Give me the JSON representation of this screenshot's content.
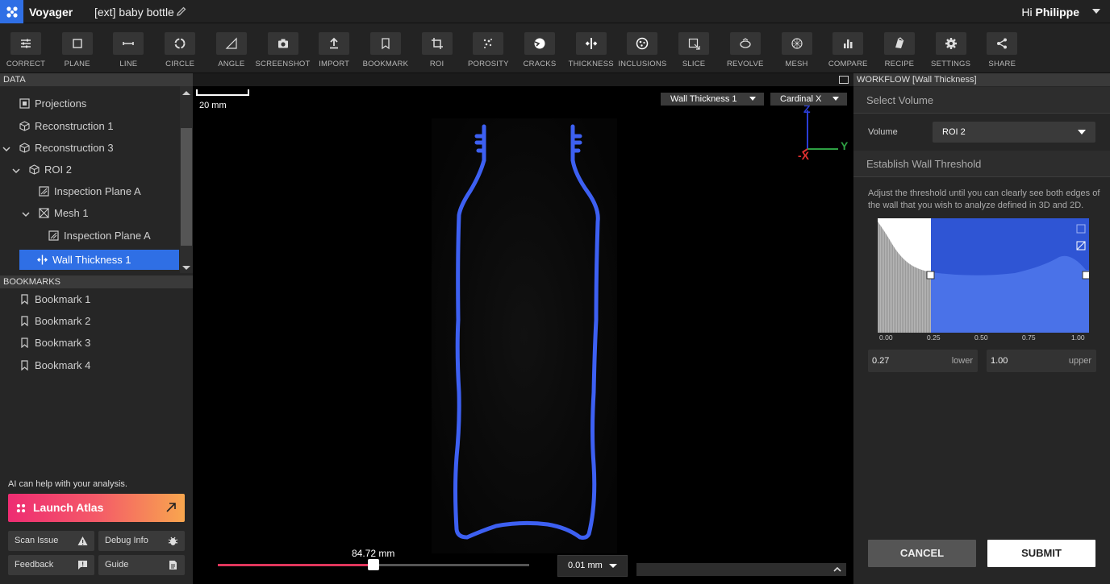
{
  "app": {
    "name": "Voyager",
    "document_title": "[ext] baby bottle",
    "greeting": "Hi",
    "user": "Philippe"
  },
  "toolbar": [
    {
      "label": "CORRECT",
      "icon": "sliders-icon"
    },
    {
      "label": "PLANE",
      "icon": "plane-icon"
    },
    {
      "label": "LINE",
      "icon": "line-icon"
    },
    {
      "label": "CIRCLE",
      "icon": "circle-icon"
    },
    {
      "label": "ANGLE",
      "icon": "angle-icon"
    },
    {
      "label": "SCREENSHOT",
      "icon": "camera-icon"
    },
    {
      "label": "IMPORT",
      "icon": "upload-icon"
    },
    {
      "label": "BOOKMARK",
      "icon": "bookmark-icon"
    },
    {
      "label": "ROI",
      "icon": "crop-icon"
    },
    {
      "label": "POROSITY",
      "icon": "porosity-icon"
    },
    {
      "label": "CRACKS",
      "icon": "cracks-icon"
    },
    {
      "label": "THICKNESS",
      "icon": "thickness-icon"
    },
    {
      "label": "INCLUSIONS",
      "icon": "inclusions-icon"
    },
    {
      "label": "SLICE",
      "icon": "slice-icon"
    },
    {
      "label": "REVOLVE",
      "icon": "revolve-icon"
    },
    {
      "label": "MESH",
      "icon": "mesh-icon"
    },
    {
      "label": "COMPARE",
      "icon": "bar-chart-icon"
    },
    {
      "label": "RECIPE",
      "icon": "recipe-icon"
    },
    {
      "label": "SETTINGS",
      "icon": "gear-icon"
    },
    {
      "label": "SHARE",
      "icon": "share-icon"
    }
  ],
  "data_panel": {
    "header": "DATA",
    "tree": [
      {
        "label": "Projections",
        "icon": "projections-icon"
      },
      {
        "label": "Reconstruction 1",
        "icon": "cube-icon"
      },
      {
        "label": "Reconstruction 3",
        "icon": "cube-icon"
      },
      {
        "label": "ROI 2",
        "icon": "cube-icon"
      },
      {
        "label": "Inspection Plane A",
        "icon": "inspection-plane-icon"
      },
      {
        "label": "Mesh 1",
        "icon": "mesh-icon"
      },
      {
        "label": "Inspection Plane A",
        "icon": "inspection-plane-icon"
      },
      {
        "label": "Wall Thickness 1",
        "icon": "thickness-icon"
      }
    ]
  },
  "bookmarks_panel": {
    "header": "BOOKMARKS",
    "items": [
      "Bookmark 1",
      "Bookmark 2",
      "Bookmark 3",
      "Bookmark 4"
    ]
  },
  "assistant": {
    "prompt": "AI can help with your analysis.",
    "launch_label": "Launch Atlas"
  },
  "footer_buttons": {
    "scan_issue": "Scan Issue",
    "debug_info": "Debug Info",
    "feedback": "Feedback",
    "guide": "Guide"
  },
  "viewport": {
    "scale_label": "20 mm",
    "layer_select": "Wall Thickness 1",
    "view_select": "Cardinal X",
    "axes": {
      "z": "Z",
      "y": "Y",
      "x": "-X"
    },
    "slice_value": "84.72 mm",
    "slice_fraction": 0.5,
    "step_select": "0.01 mm"
  },
  "workflow": {
    "header": "WORKFLOW [Wall Thickness]",
    "select_volume_title": "Select Volume",
    "volume_label": "Volume",
    "volume_value": "ROI 2",
    "threshold_title": "Establish Wall Threshold",
    "instructions": "Adjust the threshold until you can clearly see both edges of the wall that you wish to analyze defined in 3D and 2D.",
    "histogram_ticks": [
      "0.00",
      "0.25",
      "0.50",
      "0.75",
      "1.00"
    ],
    "lower_value": "0.27",
    "lower_label": "lower",
    "upper_value": "1.00",
    "upper_label": "upper",
    "cancel_label": "CANCEL",
    "submit_label": "SUBMIT"
  },
  "colors": {
    "accent": "#2f6fe5",
    "wall": "#3a5cf0",
    "slider": "#e0365c"
  }
}
